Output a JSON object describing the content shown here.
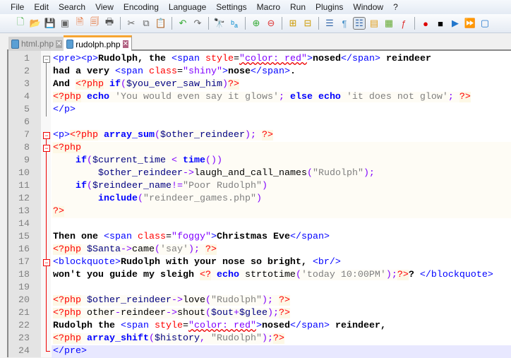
{
  "menu": [
    "File",
    "Edit",
    "Search",
    "View",
    "Encoding",
    "Language",
    "Settings",
    "Macro",
    "Run",
    "Plugins",
    "Window",
    "?"
  ],
  "toolbar": [
    {
      "icon": "new-file-icon",
      "g": "🗋",
      "c": "#4a4"
    },
    {
      "icon": "open-file-icon",
      "g": "📂",
      "c": "#e0a020"
    },
    {
      "icon": "save-icon",
      "g": "💾",
      "c": "#666"
    },
    {
      "icon": "save-all-icon",
      "g": "▣",
      "c": "#666"
    },
    {
      "icon": "close-icon",
      "g": "🗎",
      "c": "#e06020"
    },
    {
      "icon": "close-all-icon",
      "g": "🗐",
      "c": "#e06020"
    },
    {
      "icon": "print-icon",
      "g": "🖶",
      "c": "#555"
    },
    "sep",
    {
      "icon": "cut-icon",
      "g": "✂",
      "c": "#666"
    },
    {
      "icon": "copy-icon",
      "g": "⧉",
      "c": "#666"
    },
    {
      "icon": "paste-icon",
      "g": "📋",
      "c": "#c08030"
    },
    "sep",
    {
      "icon": "undo-icon",
      "g": "↶",
      "c": "#3a3"
    },
    {
      "icon": "redo-icon",
      "g": "↷",
      "c": "#666"
    },
    "sep",
    {
      "icon": "find-icon",
      "g": "🔭",
      "c": "#333"
    },
    {
      "icon": "replace-icon",
      "g": "ᵇₐ",
      "c": "#08c"
    },
    "sep",
    {
      "icon": "zoom-in-icon",
      "g": "⊕",
      "c": "#3a3"
    },
    {
      "icon": "zoom-out-icon",
      "g": "⊖",
      "c": "#d33"
    },
    "sep",
    {
      "icon": "sync-vertical-icon",
      "g": "⊞",
      "c": "#c90"
    },
    {
      "icon": "sync-horizontal-icon",
      "g": "⊟",
      "c": "#c90"
    },
    "sep",
    {
      "icon": "word-wrap-icon",
      "g": "☰",
      "c": "#36a"
    },
    {
      "icon": "show-all-chars-icon",
      "g": "¶",
      "c": "#59c"
    },
    {
      "icon": "indent-guide-icon",
      "g": "☷",
      "c": "#36a",
      "active": true
    },
    {
      "icon": "user-language-icon",
      "g": "▤",
      "c": "#e0a020"
    },
    {
      "icon": "document-map-icon",
      "g": "▦",
      "c": "#6a3"
    },
    {
      "icon": "function-list-icon",
      "g": "ƒ",
      "c": "#d33"
    },
    "sep",
    {
      "icon": "record-macro-icon",
      "g": "●",
      "c": "#d00"
    },
    {
      "icon": "stop-macro-icon",
      "g": "■",
      "c": "#000"
    },
    {
      "icon": "play-macro-icon",
      "g": "▶",
      "c": "#27c"
    },
    {
      "icon": "play-multiple-macro-icon",
      "g": "⏩",
      "c": "#27c"
    },
    {
      "icon": "save-macro-icon",
      "g": "▢",
      "c": "#27c"
    }
  ],
  "tabs": [
    {
      "label": "html.php",
      "active": false
    },
    {
      "label": "rudolph.php",
      "active": true
    }
  ],
  "lines": [
    [
      [
        "tag",
        "<pre><p>"
      ],
      [
        "t",
        "Rudolph, the "
      ],
      [
        "tag",
        "<span "
      ],
      [
        "attr",
        "style"
      ],
      [
        "eq",
        "="
      ],
      [
        "val",
        "\"color: red\""
      ],
      [
        "tag",
        ">"
      ],
      [
        "t",
        "nosed"
      ],
      [
        "tag",
        "</span>"
      ],
      [
        "t",
        " reindeer"
      ]
    ],
    [
      [
        "t",
        "had a very "
      ],
      [
        "tag",
        "<span "
      ],
      [
        "attr",
        "class"
      ],
      [
        "eq",
        "="
      ],
      [
        "val",
        "\"shiny\""
      ],
      [
        "tag",
        ">"
      ],
      [
        "t",
        "nose"
      ],
      [
        "tag",
        "</span>"
      ],
      [
        "t",
        "."
      ]
    ],
    [
      [
        "t",
        "And "
      ],
      [
        "php",
        "<?php"
      ],
      [
        "kw",
        " if"
      ],
      [
        "op",
        "("
      ],
      [
        "var",
        "$you_ever_saw_him"
      ],
      [
        "op",
        ")"
      ],
      [
        "php",
        "?>"
      ]
    ],
    [
      [
        "php",
        "<?php"
      ],
      [
        "kw",
        " echo "
      ],
      [
        "str",
        "'You would even say it glows'"
      ],
      [
        "op",
        ";"
      ],
      [
        "kw",
        " else echo "
      ],
      [
        "str",
        "'it does not glow'"
      ],
      [
        "op",
        ";"
      ],
      [
        "ps",
        " "
      ],
      [
        "php",
        "?>"
      ]
    ],
    [
      [
        "tag",
        "</p>"
      ]
    ],
    [],
    [
      [
        "tag",
        "<p>"
      ],
      [
        "php",
        "<?php"
      ],
      [
        "kw",
        " array_sum"
      ],
      [
        "op",
        "("
      ],
      [
        "var",
        "$other_reindeer"
      ],
      [
        "op",
        ");"
      ],
      [
        "ps",
        " "
      ],
      [
        "php",
        "?>"
      ]
    ],
    [
      [
        "php",
        "<?php"
      ]
    ],
    [
      [
        "ps",
        "    "
      ],
      [
        "kw",
        "if"
      ],
      [
        "op",
        "("
      ],
      [
        "var",
        "$current_time"
      ],
      [
        "op",
        " < "
      ],
      [
        "kw",
        "time"
      ],
      [
        "op",
        "())"
      ]
    ],
    [
      [
        "ps",
        "        "
      ],
      [
        "var",
        "$other_reindeer"
      ],
      [
        "op",
        "->"
      ],
      [
        "fn",
        "laugh_and_call_names"
      ],
      [
        "op",
        "("
      ],
      [
        "str",
        "\"Rudolph\""
      ],
      [
        "op",
        ");"
      ]
    ],
    [
      [
        "ps",
        "    "
      ],
      [
        "kw",
        "if"
      ],
      [
        "op",
        "("
      ],
      [
        "var",
        "$reindeer_name"
      ],
      [
        "op",
        "!="
      ],
      [
        "str",
        "\"Poor Rudolph\""
      ],
      [
        "op",
        ")"
      ]
    ],
    [
      [
        "ps",
        "        "
      ],
      [
        "kw",
        "include"
      ],
      [
        "op",
        "("
      ],
      [
        "str",
        "\"reindeer_games.php\""
      ],
      [
        "op",
        ")"
      ]
    ],
    [
      [
        "php",
        "?>"
      ]
    ],
    [],
    [
      [
        "t",
        "Then one "
      ],
      [
        "tag",
        "<span "
      ],
      [
        "attr",
        "class"
      ],
      [
        "eq",
        "="
      ],
      [
        "val",
        "\"foggy\""
      ],
      [
        "tag",
        ">"
      ],
      [
        "t",
        "Christmas Eve"
      ],
      [
        "tag",
        "</span>"
      ]
    ],
    [
      [
        "php",
        "<?php"
      ],
      [
        "var",
        " $Santa"
      ],
      [
        "op",
        "->"
      ],
      [
        "fn",
        "came"
      ],
      [
        "op",
        "("
      ],
      [
        "str",
        "'say'"
      ],
      [
        "op",
        ");"
      ],
      [
        "ps",
        " "
      ],
      [
        "php",
        "?>"
      ]
    ],
    [
      [
        "tag",
        "<blockquote>"
      ],
      [
        "t",
        "Rudolph with your nose so bright, "
      ],
      [
        "tag",
        "<br/>"
      ]
    ],
    [
      [
        "t",
        "won't you guide my sleigh "
      ],
      [
        "php",
        "<?"
      ],
      [
        "kw",
        " echo"
      ],
      [
        "fn",
        " strtotime"
      ],
      [
        "op",
        "("
      ],
      [
        "str",
        "'today 10:00PM'"
      ],
      [
        "op",
        ");"
      ],
      [
        "php",
        "?>"
      ],
      [
        "t",
        "? "
      ],
      [
        "tag",
        "</blockquote>"
      ]
    ],
    [],
    [
      [
        "php",
        "<?php"
      ],
      [
        "var",
        " $other_reindeer"
      ],
      [
        "op",
        "->"
      ],
      [
        "fn",
        "love"
      ],
      [
        "op",
        "("
      ],
      [
        "str",
        "\"Rudolph\""
      ],
      [
        "op",
        ");"
      ],
      [
        "ps",
        " "
      ],
      [
        "php",
        "?>"
      ]
    ],
    [
      [
        "php",
        "<?php"
      ],
      [
        "fn",
        " other"
      ],
      [
        "op",
        "-"
      ],
      [
        "fn",
        "reindeer"
      ],
      [
        "op",
        "->"
      ],
      [
        "fn",
        "shout"
      ],
      [
        "op",
        "("
      ],
      [
        "var",
        "$out"
      ],
      [
        "op",
        "+"
      ],
      [
        "var",
        "$glee"
      ],
      [
        "op",
        ");"
      ],
      [
        "php",
        "?>"
      ]
    ],
    [
      [
        "t",
        "Rudolph the "
      ],
      [
        "tag",
        "<span "
      ],
      [
        "attr",
        "style"
      ],
      [
        "eq",
        "="
      ],
      [
        "val",
        "\"color: red\""
      ],
      [
        "tag",
        ">"
      ],
      [
        "t",
        "nosed"
      ],
      [
        "tag",
        "</span>"
      ],
      [
        "t",
        " reindeer,"
      ]
    ],
    [
      [
        "php",
        "<?php"
      ],
      [
        "kw",
        " array_shift"
      ],
      [
        "op",
        "("
      ],
      [
        "var",
        "$history"
      ],
      [
        "op",
        ", "
      ],
      [
        "str",
        "\"Rudolph\""
      ],
      [
        "op",
        ");"
      ],
      [
        "php",
        "?>"
      ]
    ],
    [
      [
        "tag",
        "</pre>"
      ]
    ]
  ],
  "current_line": 24,
  "line_numbers": [
    "1",
    "2",
    "3",
    "4",
    "5",
    "6",
    "7",
    "8",
    "9",
    "10",
    "11",
    "12",
    "13",
    "14",
    "15",
    "16",
    "17",
    "18",
    "19",
    "20",
    "21",
    "22",
    "23",
    "24"
  ]
}
